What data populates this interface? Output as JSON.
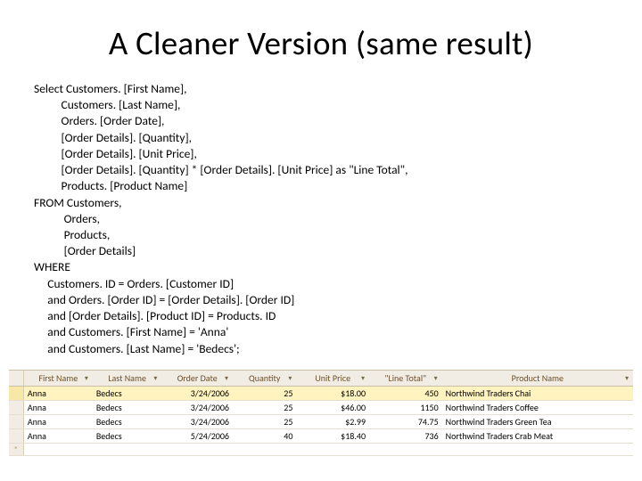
{
  "title": "A Cleaner Version (same result)",
  "sql": "Select Customers. [First Name],\n          Customers. [Last Name],\n          Orders. [Order Date],\n          [Order Details]. [Quantity],\n          [Order Details]. [Unit Price],\n          [Order Details]. [Quantity] * [Order Details]. [Unit Price] as \"Line Total\",\n          Products. [Product Name]\nFROM Customers,\n           Orders,\n           Products,\n           [Order Details]\nWHERE\n     Customers. ID = Orders. [Customer ID]\n     and Orders. [Order ID] = [Order Details]. [Order ID]\n     and [Order Details]. [Product ID] = Products. ID\n     and Customers. [First Name] = 'Anna'\n     and Customers. [Last Name] = 'Bedecs';",
  "table": {
    "headers": [
      "First Name",
      "Last Name",
      "Order Date",
      "Quantity",
      "Unit Price",
      "\"Line Total\"",
      "Product Name"
    ],
    "rows": [
      {
        "first": "Anna",
        "last": "Bedecs",
        "date": "3/24/2006",
        "qty": "25",
        "price": "$18.00",
        "lt": "450",
        "prod": "Northwind Traders Chai",
        "selected": true
      },
      {
        "first": "Anna",
        "last": "Bedecs",
        "date": "3/24/2006",
        "qty": "25",
        "price": "$46.00",
        "lt": "1150",
        "prod": "Northwind Traders Coffee",
        "selected": false
      },
      {
        "first": "Anna",
        "last": "Bedecs",
        "date": "3/24/2006",
        "qty": "25",
        "price": "$2.99",
        "lt": "74.75",
        "prod": "Northwind Traders Green Tea",
        "selected": false
      },
      {
        "first": "Anna",
        "last": "Bedecs",
        "date": "5/24/2006",
        "qty": "40",
        "price": "$18.40",
        "lt": "736",
        "prod": "Northwind Traders Crab Meat",
        "selected": false
      }
    ],
    "new_row_marker": "*"
  }
}
